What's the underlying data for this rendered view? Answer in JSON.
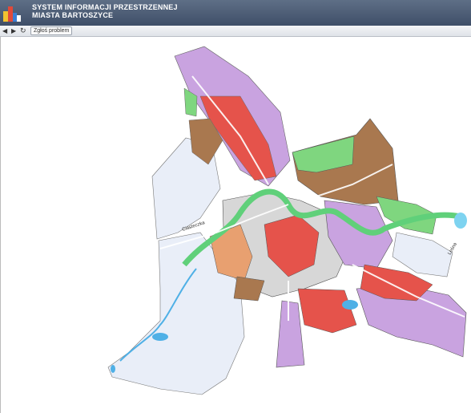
{
  "header": {
    "title_line1": "SYSTEM INFORMACJI PRZESTRZENNEJ",
    "title_line2": "MIASTA BARTOSZYCE"
  },
  "toolbar": {
    "back_icon": "triangle-left",
    "forward_icon": "triangle-right",
    "refresh_icon": "refresh",
    "report_label": "Zgłoś problem"
  },
  "map": {
    "street_label_1": "Ciasteczka",
    "street_label_2": "Leśna",
    "colors": {
      "residential_purple": "#c9a3e0",
      "commercial_red": "#e5534b",
      "green_area": "#7fd67f",
      "farmland_brown": "#a9784f",
      "light_zone": "#e9eef8",
      "water": "#4fb0e6",
      "river_green": "#60d07a",
      "service_orange": "#e8a070"
    }
  }
}
